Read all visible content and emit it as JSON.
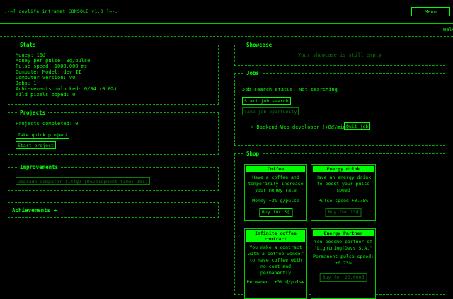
{
  "header": {
    "title": ".-=[ devlife intranet CONSOLE v1.0 ]=-.",
    "menu_label": "Menu",
    "ticker": "Welc"
  },
  "stats": {
    "title": "Stats",
    "lines": [
      "Money: 10₫",
      "Money per pulse: 3₫/pulse",
      "Pulse speed: 1000.000 ms",
      "Computer Model: dev II",
      "Computer Version: v0",
      "Jobs: 1",
      "Achievements unlocked: 0/34 (0.0%)",
      "Wild pixels poped: 0"
    ]
  },
  "projects": {
    "title": "Projects",
    "completed": "Projects completed: 0",
    "quick_label": "Take quick project",
    "start_label": "Start project"
  },
  "improvements": {
    "title": "Improvements",
    "upgrade_label": "Upgrade computer (144₫) [Development time: 10s]"
  },
  "achievements": {
    "label": "Achievements +"
  },
  "showcase": {
    "title": "Showcase",
    "empty": "Your showcase is still empty"
  },
  "jobs": {
    "title": "Jobs",
    "status": "Job search status: Not searching",
    "start_search_label": "Start job search",
    "take_opportunity_label": "Take job oportunity",
    "job_item": "• Backend Web developer (+8₫/min)",
    "quit_label": "Quit job"
  },
  "shop": {
    "title": "Shop",
    "items": [
      {
        "name": "Coffee",
        "desc": "Have a coffee and temporarily increase your money rate",
        "effect": "Money +3% ₫/pulse",
        "buy": "Buy for 5₫",
        "affordable": true
      },
      {
        "name": "Energy drink",
        "desc": "Have an energy drink to boost your pulse speed",
        "effect": "Pulse speed +0.75%",
        "buy": "Buy for 15₫",
        "affordable": false
      },
      {
        "name": "Infinite coffee contract",
        "desc": "You make a contract with a coffee vendor to have coffee with no cost and permanently",
        "effect": "Permanent +3% ₫/pulse",
        "buy": "",
        "affordable": true
      },
      {
        "name": "Energy Partner",
        "desc": "You become partner of \"Lightning|Devs S.A.\"",
        "effect": "Permanent pulse speed: +0.75%",
        "buy": "Buy for 20.000₫",
        "affordable": false
      }
    ]
  },
  "colors": {
    "accent": "#00ff00",
    "dim": "#0b7a0b",
    "background": "#000000"
  }
}
